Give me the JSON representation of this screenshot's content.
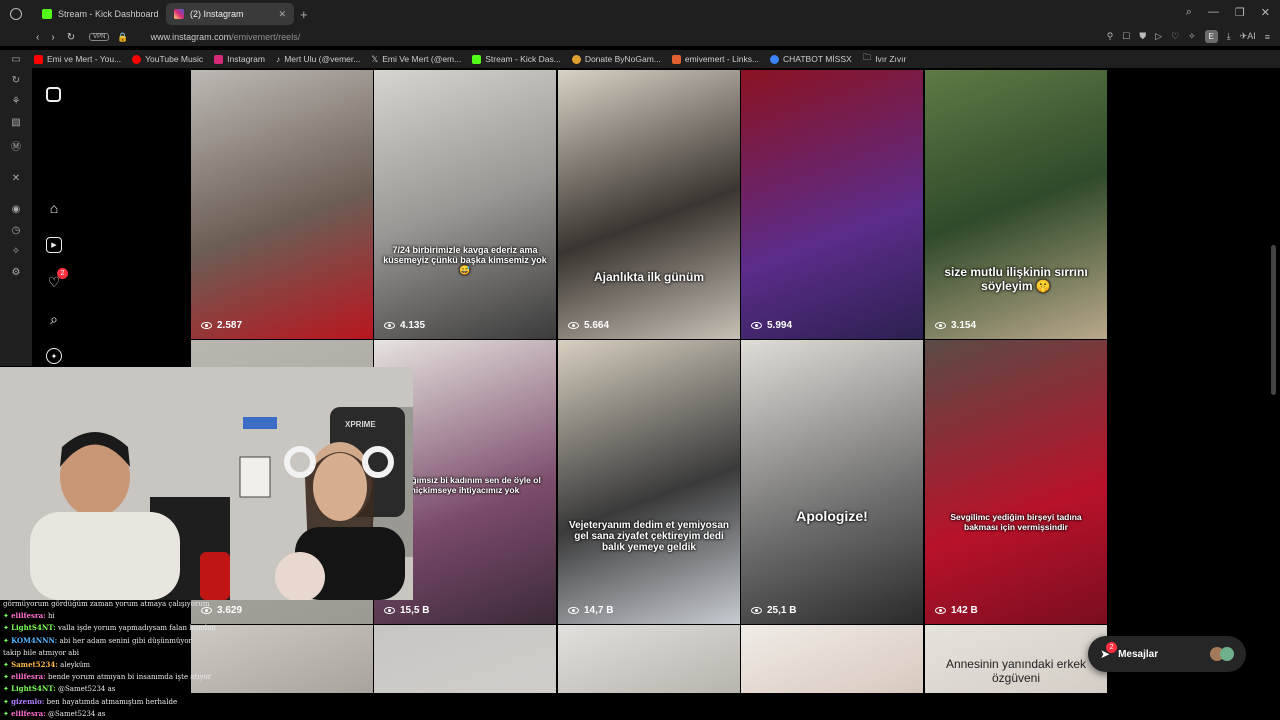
{
  "tabs": [
    {
      "label": "Stream - Kick Dashboard",
      "color": "#53fc18",
      "active": false
    },
    {
      "label": "(2) Instagram",
      "color": "#d62976",
      "active": true
    }
  ],
  "address": {
    "vpn": "VPN",
    "domain": "www.instagram.com",
    "path": "/emivemert/reels/"
  },
  "toolbar": {
    "profile_initial": "E",
    "ai_label": "AI"
  },
  "bookmarks": [
    {
      "label": "Emi ve Mert - You...",
      "color": "#ff0000"
    },
    {
      "label": "YouTube Music",
      "color": "#ff0000"
    },
    {
      "label": "Instagram",
      "color": "#d62976"
    },
    {
      "label": "Mert Ulu (@vemer...",
      "color": "#111111"
    },
    {
      "label": "Emi Ve Mert (@em...",
      "color": "#111111"
    },
    {
      "label": "Stream - Kick Das...",
      "color": "#53fc18"
    },
    {
      "label": "Donate ByNoGam...",
      "color": "#e0a030"
    },
    {
      "label": "emivemert - Links...",
      "color": "#e06030"
    },
    {
      "label": "CHATBOT MİSSX",
      "color": "#3b82f6"
    },
    {
      "label": "Ivır Zıvır",
      "color": "#888888"
    }
  ],
  "ig_nav": {
    "notification_count": "2"
  },
  "reels": [
    {
      "views": "2.587",
      "caption": ""
    },
    {
      "views": "4.135",
      "caption": "7/24 birbirimizle kavga ederiz ama küsemeyiz çünkü başka kimsemiz yok 😅"
    },
    {
      "views": "5.664",
      "caption": "Ajanlıkta ilk günüm"
    },
    {
      "views": "5.994",
      "caption": ""
    },
    {
      "views": "3.154",
      "caption": "size mutlu ilişkinin sırrını söyleyim 🤫"
    },
    {
      "views": "3.629",
      "caption": ""
    },
    {
      "views": "15,5 B",
      "caption": "en bağımsız bi kadınım sen de öyle ol hiçkimseye ihtiyacımız yok"
    },
    {
      "views": "14,7 B",
      "caption": "Vejeteryanım dedim et yemiyosan gel sana ziyafet çektireyim dedi balık yemeye geldik"
    },
    {
      "views": "25,1 B",
      "caption": "Apologize!"
    },
    {
      "views": "142 B",
      "caption": "Sevgilimc yediğim birşeyi tadına bakması için vermişsindir"
    },
    {
      "views": "",
      "caption": ""
    },
    {
      "views": "",
      "caption": ""
    },
    {
      "views": "",
      "caption": ""
    },
    {
      "views": "",
      "caption": ""
    },
    {
      "views": "",
      "caption": "Annesinin yanındaki erkek özgüveni"
    }
  ],
  "chat": [
    {
      "user": "",
      "text": "görmüyorum gördüğüm zaman yorum atmaya çalışıyorum",
      "color": "#e8e8e8"
    },
    {
      "user": "elilfesra:",
      "text": "hi",
      "color": "#ff6fd0"
    },
    {
      "user": "LightS4NT:",
      "text": "valla işde yorum yapmadıysam falan bundan",
      "color": "#7dff5a"
    },
    {
      "user": "KOM4NNN:",
      "text": "abi her adam senini gibi düşünmüyor",
      "color": "#58b4ff"
    },
    {
      "user": "",
      "text": "takip bile atmıyor abi",
      "color": "#e8e8e8"
    },
    {
      "user": "Samet5234:",
      "text": "aleyküm",
      "color": "#ffb84a"
    },
    {
      "user": "elilfesra:",
      "text": "bende yorum atmıyan bi insanımda işte atıyor",
      "color": "#ff6fd0"
    },
    {
      "user": "LightS4NT:",
      "text": "@Samet5234 as",
      "color": "#7dff5a"
    },
    {
      "user": "gizemlo:",
      "text": "ben hayatımda atmamıştım herhalde",
      "color": "#b07dff"
    },
    {
      "user": "elilfesra:",
      "text": "@Samet5234 as",
      "color": "#ff6fd0"
    }
  ],
  "messages": {
    "label": "Mesajlar",
    "count": "2"
  }
}
